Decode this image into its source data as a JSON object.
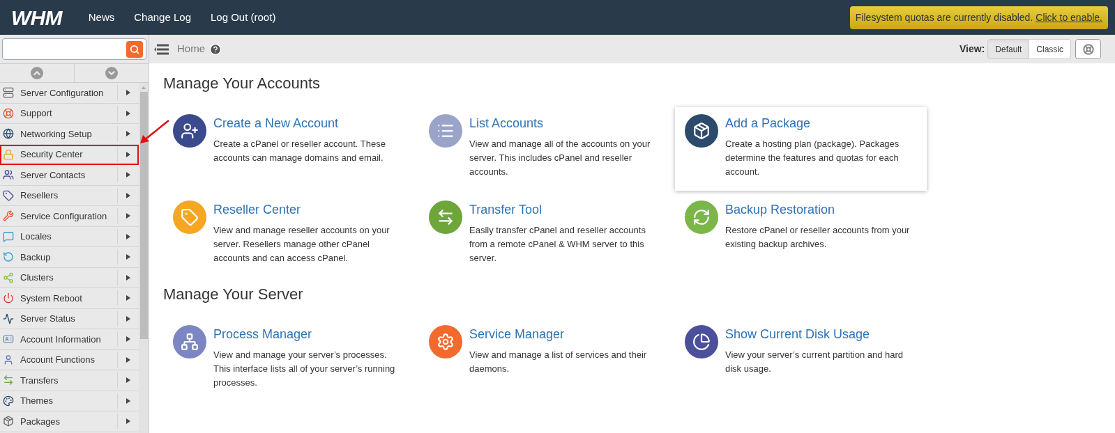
{
  "header": {
    "logo": "WHM",
    "nav": [
      "News",
      "Change Log",
      "Log Out (root)"
    ],
    "notice": {
      "text": "Filesystem quotas are currently disabled.",
      "link": "Click to enable."
    }
  },
  "toolbar": {
    "breadcrumb": "Home",
    "view_label": "View:",
    "views": [
      {
        "label": "Default",
        "selected": true
      },
      {
        "label": "Classic",
        "selected": false
      }
    ]
  },
  "sidebar": {
    "items": [
      {
        "label": "Server Configuration",
        "kind": "server",
        "highlighted": false
      },
      {
        "label": "Support",
        "kind": "support",
        "highlighted": false
      },
      {
        "label": "Networking Setup",
        "kind": "network",
        "highlighted": false
      },
      {
        "label": "Security Center",
        "kind": "lock",
        "highlighted": true
      },
      {
        "label": "Server Contacts",
        "kind": "contacts",
        "highlighted": false
      },
      {
        "label": "Resellers",
        "kind": "tag",
        "highlighted": false
      },
      {
        "label": "Service Configuration",
        "kind": "wrench",
        "highlighted": false
      },
      {
        "label": "Locales",
        "kind": "chat",
        "highlighted": false
      },
      {
        "label": "Backup",
        "kind": "backup",
        "highlighted": false
      },
      {
        "label": "Clusters",
        "kind": "cluster",
        "highlighted": false
      },
      {
        "label": "System Reboot",
        "kind": "power",
        "highlighted": false
      },
      {
        "label": "Server Status",
        "kind": "monitor",
        "highlighted": false
      },
      {
        "label": "Account Information",
        "kind": "card",
        "highlighted": false
      },
      {
        "label": "Account Functions",
        "kind": "user",
        "highlighted": false
      },
      {
        "label": "Transfers",
        "kind": "transfer",
        "highlighted": false
      },
      {
        "label": "Themes",
        "kind": "theme",
        "highlighted": false
      },
      {
        "label": "Packages",
        "kind": "package",
        "highlighted": false
      }
    ]
  },
  "sections": [
    {
      "title": "Manage Your Accounts",
      "cards": [
        {
          "title": "Create a New Account",
          "description": "Create a cPanel or reseller account. These accounts can manage domains and email.",
          "kind": "user-add",
          "raised": false
        },
        {
          "title": "List Accounts",
          "description": "View and manage all of the accounts on your server. This includes cPanel and reseller accounts.",
          "kind": "list",
          "raised": false
        },
        {
          "title": "Add a Package",
          "description": "Create a hosting plan (package). Packages determine the features and quotas for each account.",
          "kind": "package",
          "raised": true
        },
        {
          "title": "Reseller Center",
          "description": "View and manage reseller accounts on your server. Resellers manage other cPanel accounts and can access cPanel.",
          "kind": "reseller",
          "raised": false
        },
        {
          "title": "Transfer Tool",
          "description": "Easily transfer cPanel and reseller accounts from a remote cPanel & WHM server to this server.",
          "kind": "transfer",
          "raised": false
        },
        {
          "title": "Backup Restoration",
          "description": "Restore cPanel or reseller accounts from your existing backup archives.",
          "kind": "restore",
          "raised": false
        }
      ]
    },
    {
      "title": "Manage Your Server",
      "cards": [
        {
          "title": "Process Manager",
          "description": "View and manage your server’s processes. This interface lists all of your server’s running processes.",
          "kind": "process",
          "raised": false
        },
        {
          "title": "Service Manager",
          "description": "View and manage a list of services and their daemons.",
          "kind": "service",
          "raised": false
        },
        {
          "title": "Show Current Disk Usage",
          "description": "View your server’s current partition and hard disk usage.",
          "kind": "disk",
          "raised": false
        }
      ]
    }
  ]
}
